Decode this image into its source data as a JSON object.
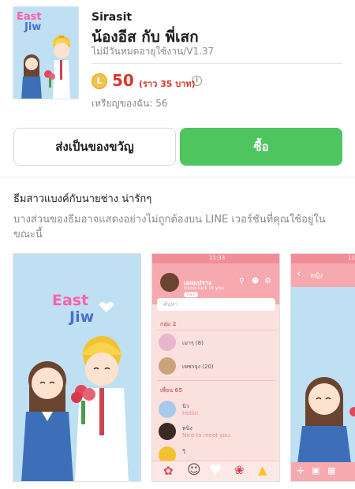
{
  "product": {
    "author": "Sirasit",
    "title": "น้องอีส กับ พี่เสก",
    "validity": "ไม่มีวันหมดอายุใช้งาน/V1.37",
    "coin_symbol": "L",
    "price_coins": "50",
    "price_approx": "(ราว  35 บาท)",
    "info_symbol": "i",
    "balance": "เหรียญของฉัน: 56",
    "thumbnail_text": [
      "East",
      "Jiw"
    ]
  },
  "actions": {
    "gift_label": "ส่งเป็นของขวัญ",
    "buy_label": "ซื้อ"
  },
  "details": {
    "description": "ธีมสาวแบงค์กับนายช่าง น่ารักๆ",
    "notice": "บางส่วนของธีมอาจแสดงอย่างไม่ถูกต้องบน LINE เวอร์ชันที่คุณใช้อยู่ในขณะนี้"
  },
  "previews": {
    "preview1_text": [
      "East",
      "Jiw"
    ],
    "preview2": {
      "time": "11:33",
      "profile_name": "เฌอเปราง",
      "profile_sub": "Good luck to you",
      "profile_tag": "Fav",
      "search_placeholder": "ค้นหา",
      "group_header": "กลุ่ม 2",
      "group_items": [
        "เมาๆ (8)",
        "เพชรจุง (20)"
      ],
      "friends_header": "เพื่อน 65",
      "friend_items": [
        {
          "name": "นิว",
          "message": "Hello!"
        },
        {
          "name": "หนิง",
          "message": "Nice to meet you."
        },
        {
          "name": "วี",
          "message": ""
        }
      ]
    },
    "preview3": {
      "time": "11",
      "chat_title": "หญิง"
    }
  },
  "colors": {
    "buy_green": "#4ec55f",
    "price_red": "#d9362c",
    "thumb_blue": "#bfe0f3",
    "theme_pink": "#f6a9ae",
    "title_pink": "#ff5fa8",
    "title_blue": "#4a6fd1"
  }
}
